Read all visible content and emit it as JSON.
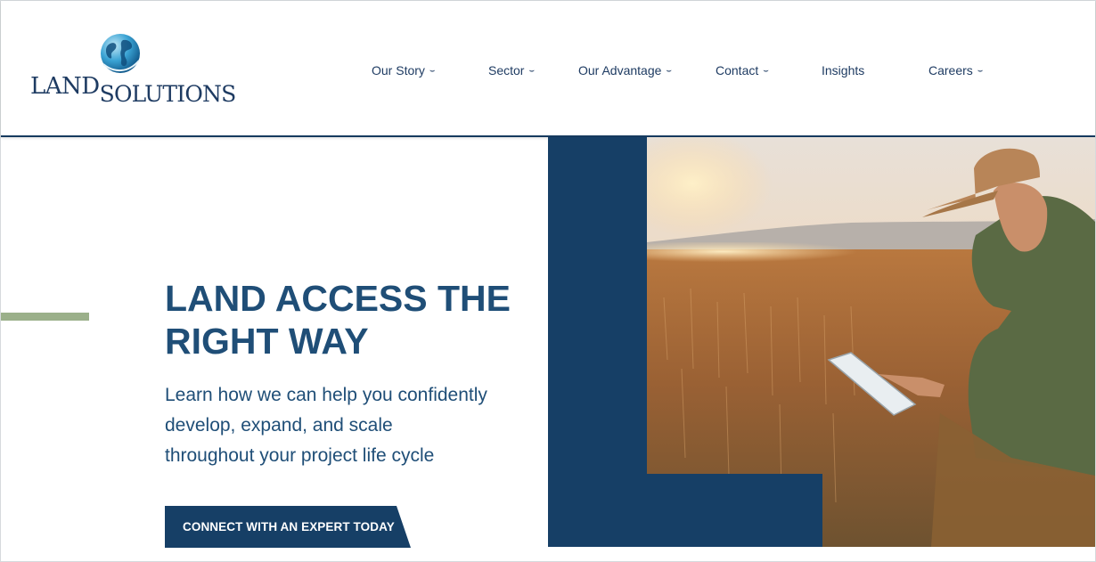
{
  "logo": {
    "part1": "LAND",
    "part2": "SOLUTIONS"
  },
  "nav": [
    {
      "label": "Our Story",
      "has_dropdown": true
    },
    {
      "label": "Sector",
      "has_dropdown": true
    },
    {
      "label": "Our Advantage",
      "has_dropdown": true
    },
    {
      "label": "Contact",
      "has_dropdown": true
    },
    {
      "label": "Insights",
      "has_dropdown": false
    },
    {
      "label": "Careers",
      "has_dropdown": true
    }
  ],
  "hero": {
    "title_line1": "LAND ACCESS THE",
    "title_line2": "RIGHT WAY",
    "subtitle_line1": "Learn how we can help you confidently",
    "subtitle_line2": "develop, expand, and scale",
    "subtitle_line3": "throughout your project life cycle",
    "cta_label": "CONNECT WITH AN EXPERT TODAY"
  },
  "colors": {
    "navy": "#163f66",
    "heading_blue": "#1f4e77",
    "accent_green": "#9bb08a"
  },
  "icons": {
    "dropdown": "chevron-down-icon",
    "logo_mark": "globe-icon"
  }
}
